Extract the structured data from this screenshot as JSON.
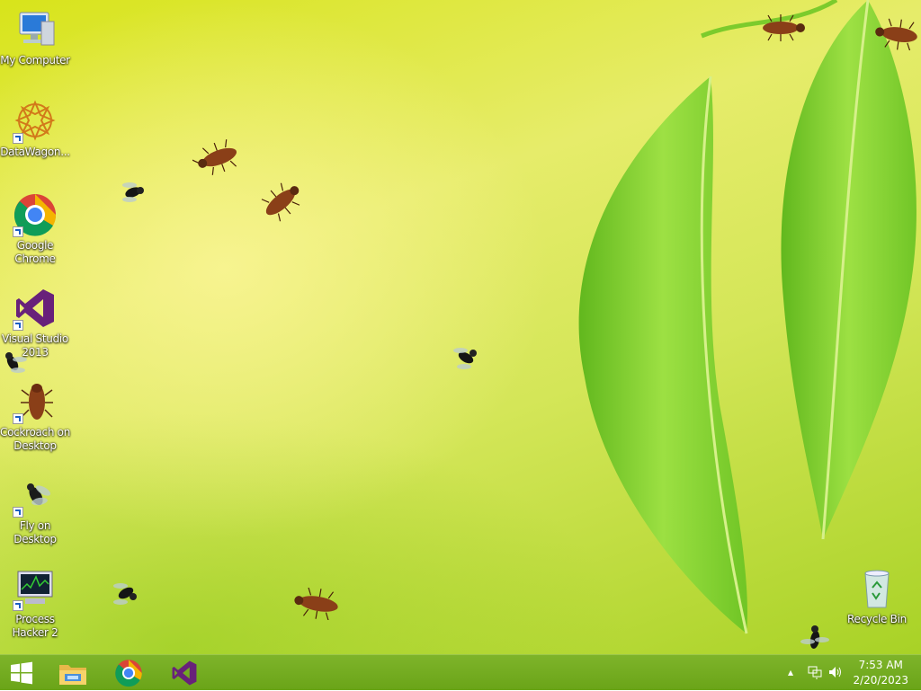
{
  "desktop": {
    "icons": [
      {
        "label": "My Computer",
        "icon": "my-computer-icon"
      },
      {
        "label": "DataWagon...",
        "icon": "datawagon-icon"
      },
      {
        "label": "Google Chrome",
        "icon": "chrome-icon"
      },
      {
        "label": "Visual Studio 2013",
        "icon": "visual-studio-icon"
      },
      {
        "label": "Cockroach on Desktop",
        "icon": "cockroach-icon"
      },
      {
        "label": "Fly on Desktop",
        "icon": "fly-icon"
      },
      {
        "label": "Process Hacker 2",
        "icon": "process-hacker-icon"
      }
    ],
    "recycle_bin": {
      "label": "Recycle Bin",
      "icon": "recycle-bin-icon"
    }
  },
  "taskbar": {
    "start": "windows-logo-icon",
    "pinned": [
      "file-explorer-icon",
      "chrome-icon",
      "visual-studio-icon"
    ],
    "tray": [
      "show-hidden-icons-icon",
      "network-icon",
      "volume-icon"
    ],
    "clock": {
      "time": "7:53 AM",
      "date": "2/20/2023"
    }
  },
  "colors": {
    "taskbar": "#72ac1e",
    "accent_vs": "#68217a"
  }
}
